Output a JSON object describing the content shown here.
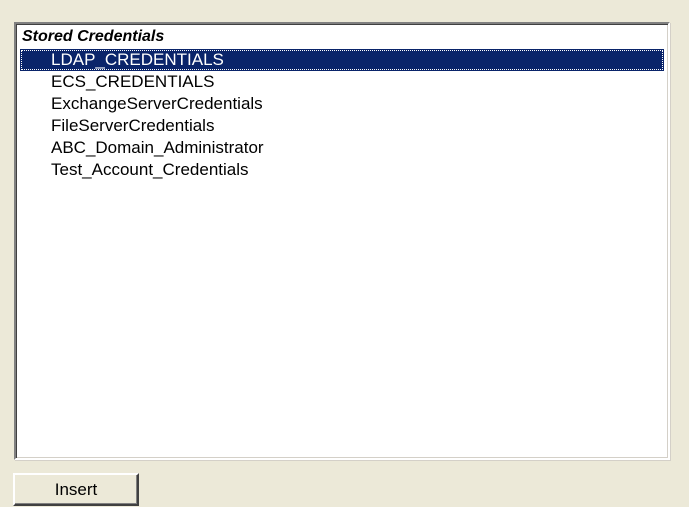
{
  "listbox": {
    "header": "Stored Credentials",
    "items": [
      {
        "label": "LDAP_CREDENTIALS",
        "selected": true
      },
      {
        "label": "ECS_CREDENTIALS",
        "selected": false
      },
      {
        "label": "ExchangeServerCredentials",
        "selected": false
      },
      {
        "label": "FileServerCredentials",
        "selected": false
      },
      {
        "label": "ABC_Domain_Administrator",
        "selected": false
      },
      {
        "label": "Test_Account_Credentials",
        "selected": false
      }
    ]
  },
  "buttons": {
    "insert_label": "Insert"
  },
  "colors": {
    "background": "#ece9d8",
    "selection": "#0a246a",
    "list_background": "#ffffff"
  }
}
